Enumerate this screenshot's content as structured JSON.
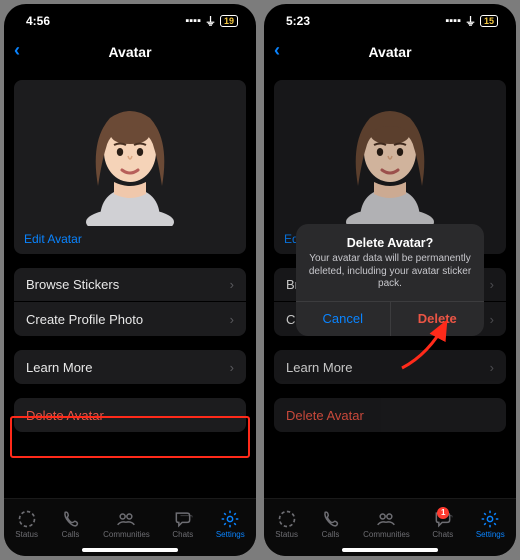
{
  "left": {
    "status": {
      "time": "4:56",
      "battery": "19"
    },
    "title": "Avatar",
    "edit": "Edit Avatar",
    "rows": {
      "browse": "Browse Stickers",
      "create": "Create Profile Photo",
      "learn": "Learn More",
      "delete": "Delete Avatar"
    }
  },
  "right": {
    "status": {
      "time": "5:23",
      "battery": "15"
    },
    "title": "Avatar",
    "edit": "Edit Avatar",
    "rows": {
      "browse": "Browse Stickers",
      "create": "Create Profile Photo",
      "learn": "Learn More",
      "delete": "Delete Avatar"
    },
    "dialog": {
      "title": "Delete Avatar?",
      "message": "Your avatar data will be permanently deleted, including your avatar sticker pack.",
      "cancel": "Cancel",
      "delete": "Delete"
    },
    "badge": "1"
  },
  "tabs": {
    "status": "Status",
    "calls": "Calls",
    "communities": "Communities",
    "chats": "Chats",
    "settings": "Settings"
  }
}
